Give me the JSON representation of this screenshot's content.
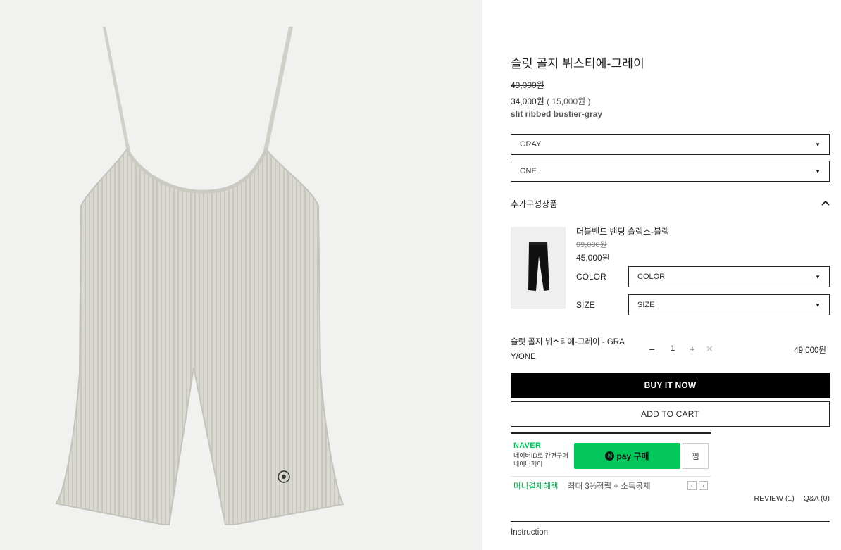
{
  "product": {
    "title": "슬릿 골지 뷔스티에-그레이",
    "original_price": "49,000원",
    "sale_price": "34,000원",
    "discount": "( 15,000원 )",
    "english_name": "slit ribbed bustier-gray"
  },
  "options": {
    "color_selected": "GRAY",
    "size_selected": "ONE",
    "arrow": "▼"
  },
  "addon": {
    "heading": "추가구성상품",
    "toggle_icon": "chevron-up-icon",
    "name": "더블밴드 밴딩 슬랙스-블랙",
    "original_price": "99,000원",
    "sale_price": "45,000원",
    "color_label": "COLOR",
    "color_value": "COLOR",
    "size_label": "SIZE",
    "size_value": "SIZE"
  },
  "selected_item": {
    "name": "슬릿 골지 뷔스티에-그레이 - GRA Y/ONE",
    "minus": "–",
    "quantity": "1",
    "plus": "+",
    "remove": "✕",
    "price": "49,000원"
  },
  "buttons": {
    "buy_now": "BUY IT NOW",
    "add_to_cart": "ADD TO CART"
  },
  "naver_pay": {
    "brand": "NAVER",
    "desc": "네이버ID로 간편구매 네이버페이",
    "pay_icon": "N",
    "pay_label": "pay 구매",
    "zzim": "찜",
    "benefit_label": "머니결제혜택",
    "benefit_detail": "최대 3%적립 + 소득공제",
    "prev": "‹",
    "next": "›",
    "brand_color": "#03c75a"
  },
  "tabs": {
    "review": "REVIEW (1)",
    "qna": "Q&A (0)"
  },
  "instruction": "Instruction"
}
